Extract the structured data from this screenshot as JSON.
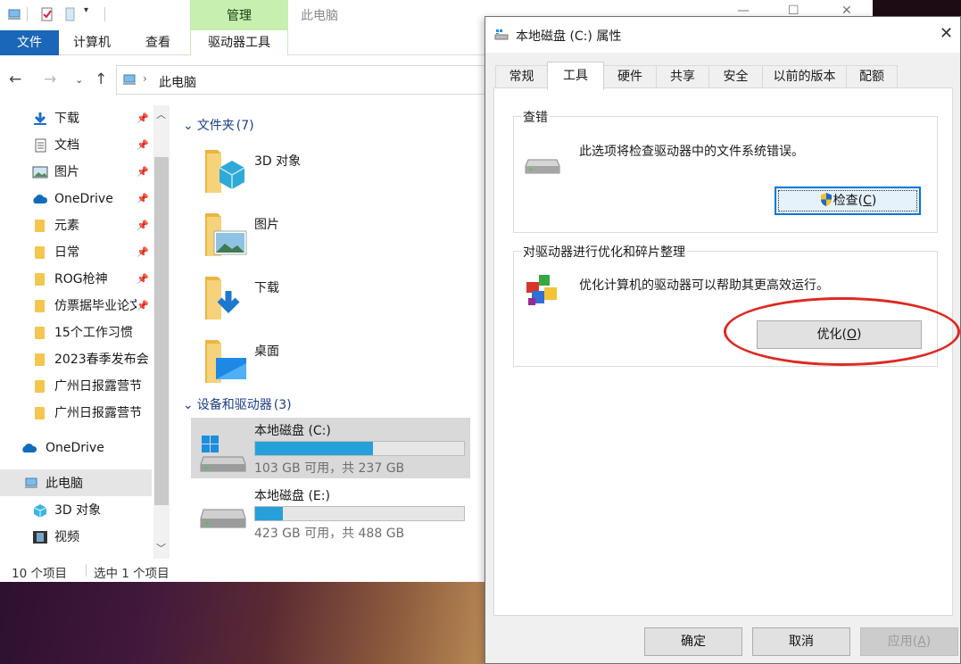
{
  "explorer": {
    "title_bar": {
      "context_tab": "管理",
      "title": "此电脑",
      "minimize": "—",
      "maximize": "☐",
      "close": "✕"
    },
    "ribbon": {
      "file": "文件",
      "computer": "计算机",
      "view": "查看",
      "drive_tools": "驱动器工具"
    },
    "address": {
      "path": "此电脑"
    },
    "nav_items": [
      {
        "label": "下载",
        "pinned": true
      },
      {
        "label": "文档",
        "pinned": true
      },
      {
        "label": "图片",
        "pinned": true
      },
      {
        "label": "OneDrive",
        "pinned": true
      },
      {
        "label": "元素",
        "pinned": true
      },
      {
        "label": "日常",
        "pinned": true
      },
      {
        "label": "ROG枪神",
        "pinned": true
      },
      {
        "label": "仿票据毕业论文",
        "pinned": true
      },
      {
        "label": "15个工作习惯"
      },
      {
        "label": "2023春季发布会"
      },
      {
        "label": "广州日报露营节"
      },
      {
        "label": "广州日报露营节"
      },
      {
        "label": "OneDrive"
      },
      {
        "label": "此电脑"
      },
      {
        "label": "3D 对象"
      },
      {
        "label": "视频"
      }
    ],
    "folders_group": {
      "label": "文件夹",
      "count": "(7)"
    },
    "folders": [
      {
        "name": "3D 对象",
        "icon": "3d-objects-folder-icon"
      },
      {
        "name": "图片",
        "icon": "pictures-folder-icon"
      },
      {
        "name": "下载",
        "icon": "downloads-folder-icon"
      },
      {
        "name": "桌面",
        "icon": "desktop-folder-icon"
      }
    ],
    "devices_group": {
      "label": "设备和驱动器",
      "count": "(3)"
    },
    "drives": [
      {
        "name": "本地磁盘 (C:)",
        "free_text": "103 GB 可用，共 237 GB",
        "used_fraction": 0.565,
        "selected": true
      },
      {
        "name": "本地磁盘 (E:)",
        "free_text": "423 GB 可用，共 488 GB",
        "used_fraction": 0.133,
        "selected": false
      }
    ],
    "status": {
      "count": "10 个项目",
      "selected": "选中 1 个项目"
    }
  },
  "dialog": {
    "title": "本地磁盘 (C:) 属性",
    "tabs": [
      "常规",
      "工具",
      "硬件",
      "共享",
      "安全",
      "以前的版本",
      "配额"
    ],
    "active_tab": "工具",
    "error_check": {
      "label": "查错",
      "description": "此选项将检查驱动器中的文件系统错误。",
      "button_text": "检查(",
      "button_key": "C",
      "button_end": ")"
    },
    "optimize": {
      "label": "对驱动器进行优化和碎片整理",
      "description": "优化计算机的驱动器可以帮助其更高效运行。",
      "button_text": "优化(",
      "button_key": "O",
      "button_end": ")"
    },
    "footer": {
      "ok": "确定",
      "cancel": "取消",
      "apply_text": "应用(",
      "apply_key": "A",
      "apply_end": ")"
    }
  },
  "colors": {
    "accent": "#1a66b8",
    "progress": "#26a0da",
    "ring": "#dc2a23",
    "context_tab": "#c6efb0"
  }
}
